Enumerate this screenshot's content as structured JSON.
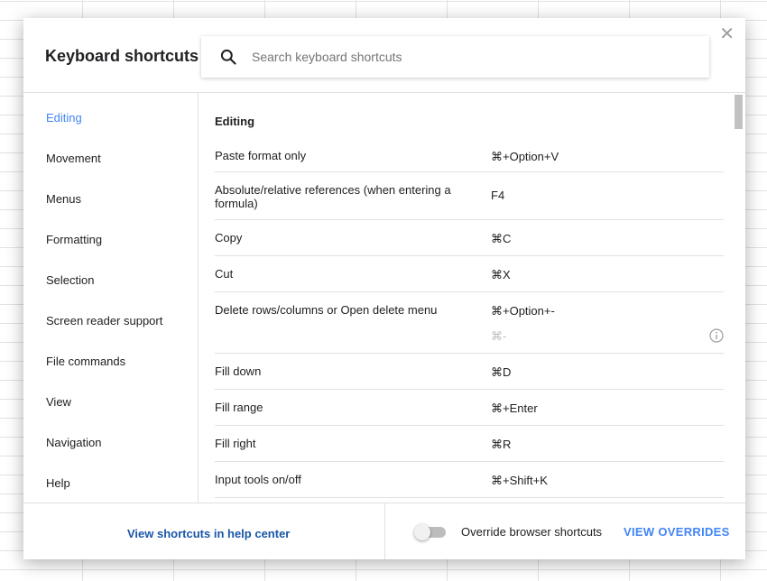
{
  "dialog": {
    "title": "Keyboard shortcuts",
    "close_glyph": "✕",
    "search_placeholder": "Search keyboard shortcuts"
  },
  "sidebar": {
    "items": [
      {
        "label": "Editing",
        "active": true
      },
      {
        "label": "Movement"
      },
      {
        "label": "Menus"
      },
      {
        "label": "Formatting"
      },
      {
        "label": "Selection"
      },
      {
        "label": "Screen reader support"
      },
      {
        "label": "File commands"
      },
      {
        "label": "View"
      },
      {
        "label": "Navigation"
      },
      {
        "label": "Help"
      }
    ]
  },
  "content": {
    "section_title": "Editing",
    "shortcuts": [
      {
        "label": "Paste format only",
        "key": "⌘+Option+V"
      },
      {
        "label": "Absolute/relative references (when entering a formula)",
        "key": "F4"
      },
      {
        "label": "Copy",
        "key": "⌘C"
      },
      {
        "label": "Cut",
        "key": "⌘X"
      },
      {
        "label": "Delete rows/columns or Open delete menu",
        "key": "⌘+Option+-",
        "alt_key": "⌘-"
      },
      {
        "label": "Fill down",
        "key": "⌘D"
      },
      {
        "label": "Fill range",
        "key": "⌘+Enter"
      },
      {
        "label": "Fill right",
        "key": "⌘R"
      },
      {
        "label": "Input tools on/off",
        "key": "⌘+Shift+K"
      }
    ]
  },
  "footer": {
    "help_link": "View shortcuts in help center",
    "override_label": "Override browser shortcuts",
    "override_enabled": false,
    "view_overrides": "VIEW OVERRIDES"
  },
  "colors": {
    "accent": "#4285f4",
    "link": "#1a56a8"
  },
  "icons": {
    "search": "search-icon",
    "close": "close-icon",
    "info": "info-icon"
  }
}
